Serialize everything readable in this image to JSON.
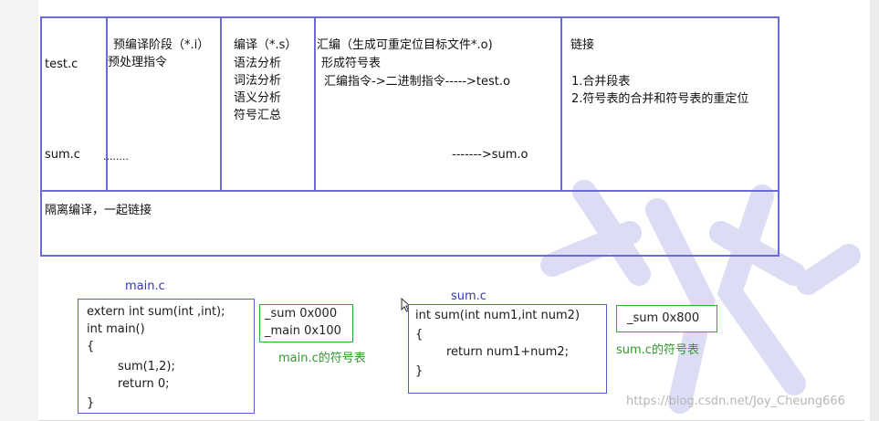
{
  "table": {
    "row_files": [
      "test.c",
      "sum.c"
    ],
    "col_preprocess": {
      "title": "预编译阶段（*.i）",
      "line2": "预处理指令",
      "sum_cell": "........"
    },
    "col_compile": {
      "title": "编译（*.s）",
      "items": [
        "语法分析",
        "词法分析",
        "语义分析",
        "符号汇总"
      ]
    },
    "col_assemble": {
      "title": "汇编（生成可重定位目标文件*.o)",
      "line2": "形成符号表",
      "line3": "汇编指令->二进制指令----->test.o",
      "sum_cell": "------->sum.o"
    },
    "col_link": {
      "title": "链接",
      "items": [
        "1.合并段表",
        "2.符号表的合并和符号表的重定位"
      ]
    },
    "bottom_note": "隔离编译，一起链接"
  },
  "main_file": {
    "label": "main.c",
    "code": [
      "extern int sum(int ,int);",
      "int main()",
      "{",
      "sum(1,2);",
      "return 0;",
      "}"
    ],
    "symbols": [
      "_sum    0x000",
      "_main  0x100"
    ],
    "symtab_label": "main.c的符号表"
  },
  "sum_file": {
    "label": "sum.c",
    "code": [
      "int sum(int num1,int num2)",
      "{",
      "return num1+num2;",
      "}"
    ],
    "symbols": [
      "_sum    0x800"
    ],
    "symtab_label": "sum.c的符号表"
  },
  "watermark": "https://blog.csdn.net/Joy_Cheung666",
  "colors": {
    "table_border": "#6a6ad8",
    "code_border": "#5a5ad0",
    "symbol_border": "#33aa33",
    "symtab_label": "#2e9a2e",
    "file_label": "#3636b8",
    "watermark_shape": "#dcdcf5"
  }
}
